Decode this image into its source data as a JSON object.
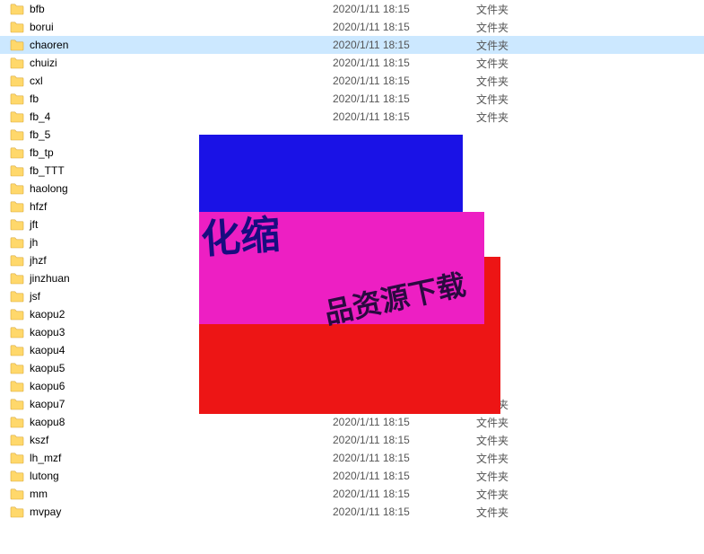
{
  "type_label": "文件夹",
  "date_value": "2020/1/11 18:15",
  "selected_index": 2,
  "files": [
    {
      "name": "bfb",
      "show_meta": true
    },
    {
      "name": "borui",
      "show_meta": true
    },
    {
      "name": "chaoren",
      "show_meta": true
    },
    {
      "name": "chuizi",
      "show_meta": true
    },
    {
      "name": "cxl",
      "show_meta": true
    },
    {
      "name": "fb",
      "show_meta": true
    },
    {
      "name": "fb_4",
      "show_meta": true
    },
    {
      "name": "fb_5",
      "show_meta": false
    },
    {
      "name": "fb_tp",
      "show_meta": false
    },
    {
      "name": "fb_TTT",
      "show_meta": false
    },
    {
      "name": "haolong",
      "show_meta": false
    },
    {
      "name": "hfzf",
      "show_meta": false
    },
    {
      "name": "jft",
      "show_meta": false
    },
    {
      "name": "jh",
      "show_meta": false
    },
    {
      "name": "jhzf",
      "show_meta": false
    },
    {
      "name": "jinzhuan",
      "show_meta": false
    },
    {
      "name": "jsf",
      "show_meta": false
    },
    {
      "name": "kaopu2",
      "show_meta": false
    },
    {
      "name": "kaopu3",
      "show_meta": false
    },
    {
      "name": "kaopu4",
      "show_meta": false
    },
    {
      "name": "kaopu5",
      "show_meta": false
    },
    {
      "name": "kaopu6",
      "show_meta": false
    },
    {
      "name": "kaopu7",
      "show_meta": true
    },
    {
      "name": "kaopu8",
      "show_meta": true
    },
    {
      "name": "kszf",
      "show_meta": true
    },
    {
      "name": "lh_mzf",
      "show_meta": true
    },
    {
      "name": "lutong",
      "show_meta": true
    },
    {
      "name": "mm",
      "show_meta": true
    },
    {
      "name": "mvpay",
      "show_meta": true
    }
  ],
  "overlay_text": {
    "line1": "化缩",
    "line2": "品资源下载"
  }
}
